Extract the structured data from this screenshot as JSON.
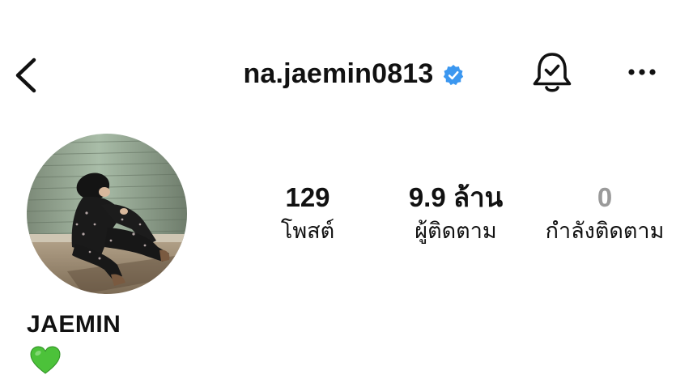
{
  "header": {
    "username": "na.jaemin0813",
    "icons": {
      "back": "chevron-left-icon",
      "verified": "verified-badge-icon",
      "notifications": "bell-check-icon",
      "more": "more-horizontal-icon"
    },
    "verified_color": "#3b97f0"
  },
  "profile": {
    "display_name": "JAEMIN",
    "bio_icon": "green-heart-icon",
    "bio_color": "#4cc23a"
  },
  "stats": {
    "posts": {
      "count": "129",
      "label": "โพสต์"
    },
    "followers": {
      "count": "9.9 ล้าน",
      "label": "ผู้ติดตาม"
    },
    "following": {
      "count": "0",
      "label": "กำลังติดตาม"
    }
  }
}
